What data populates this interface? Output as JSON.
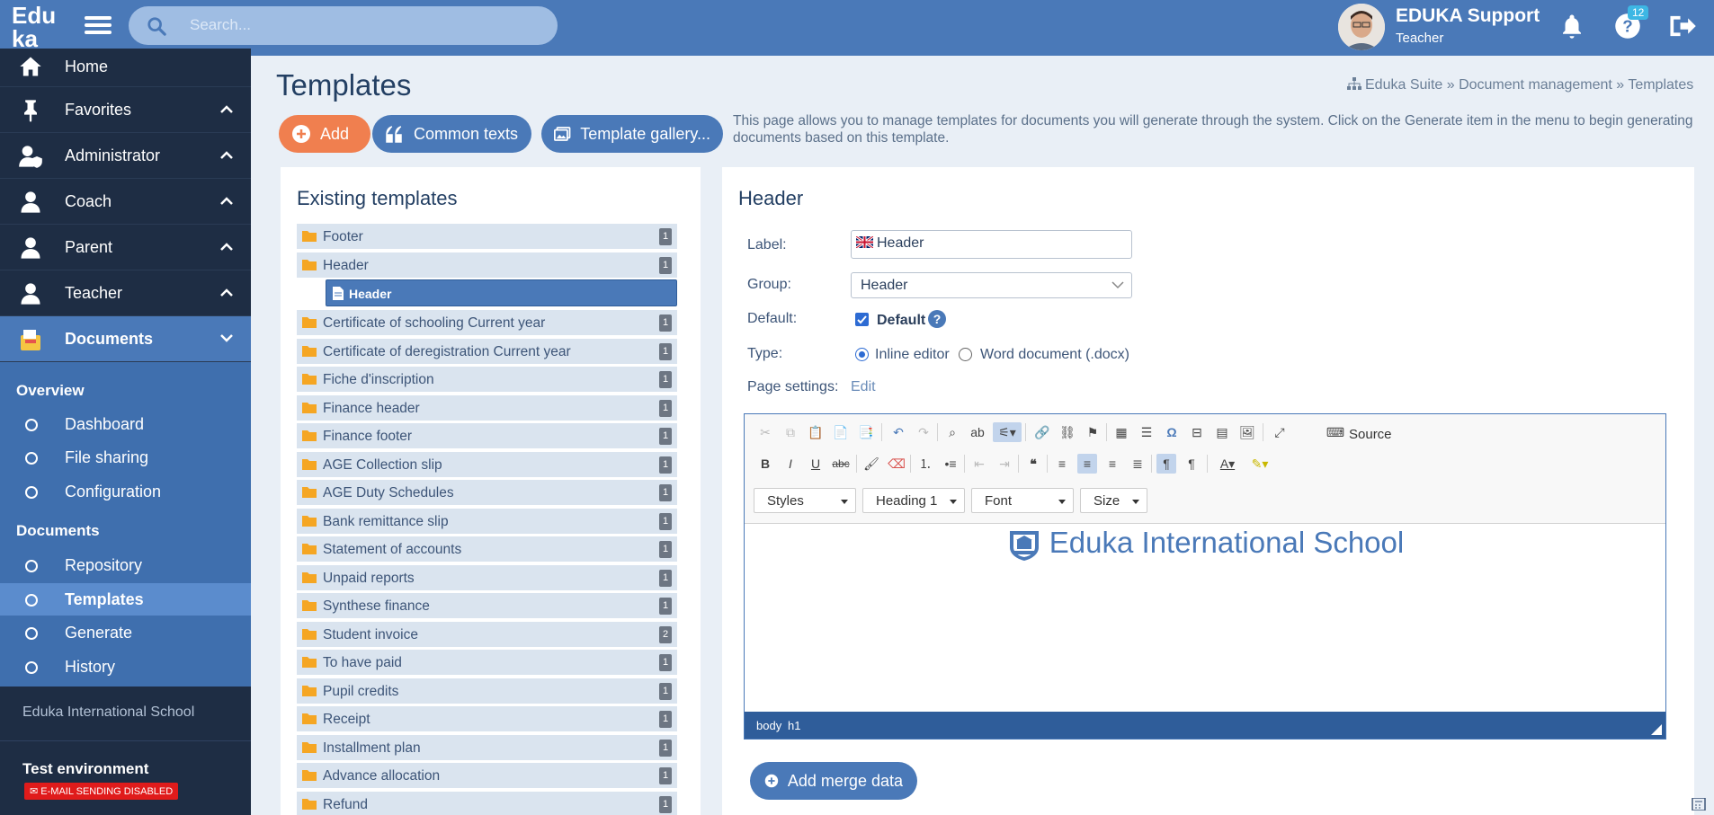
{
  "brand": {
    "logo_line1": "Edu",
    "logo_line2": "ka"
  },
  "search": {
    "placeholder": "Search..."
  },
  "user": {
    "name": "EDUKA Support",
    "role": "Teacher"
  },
  "notifications": {
    "help_count": "12"
  },
  "sidebar": {
    "items": [
      {
        "label": "Home"
      },
      {
        "label": "Favorites"
      },
      {
        "label": "Administrator"
      },
      {
        "label": "Coach"
      },
      {
        "label": "Parent"
      },
      {
        "label": "Teacher"
      },
      {
        "label": "Documents"
      }
    ],
    "sections": [
      {
        "title": "Overview",
        "items": [
          "Dashboard",
          "File sharing",
          "Configuration"
        ]
      },
      {
        "title": "Documents",
        "items": [
          "Repository",
          "Templates",
          "Generate",
          "History"
        ]
      }
    ],
    "selected_item": "Templates",
    "school": "Eduka International School",
    "env_label": "Test environment",
    "env_badge": "E-MAIL SENDING DISABLED"
  },
  "page": {
    "title": "Templates",
    "breadcrumb": "Eduka Suite » Document management » Templates",
    "buttons": {
      "add": "Add",
      "common_texts": "Common texts",
      "gallery": "Template gallery..."
    },
    "intro": "This page allows you to manage templates for documents you will generate through the system. Click on the Generate item in the menu to begin generating documents based on this template."
  },
  "templates": {
    "title": "Existing templates",
    "rows": [
      {
        "label": "Footer",
        "count": "1"
      },
      {
        "label": "Header",
        "count": "1"
      },
      {
        "label": "Certificate of schooling Current year",
        "count": "1"
      },
      {
        "label": "Certificate of deregistration Current year",
        "count": "1"
      },
      {
        "label": "Fiche d'inscription",
        "count": "1"
      },
      {
        "label": "Finance header",
        "count": "1"
      },
      {
        "label": "Finance footer",
        "count": "1"
      },
      {
        "label": "AGE Collection slip",
        "count": "1"
      },
      {
        "label": "AGE Duty Schedules",
        "count": "1"
      },
      {
        "label": "Bank remittance slip",
        "count": "1"
      },
      {
        "label": "Statement of accounts",
        "count": "1"
      },
      {
        "label": "Unpaid reports",
        "count": "1"
      },
      {
        "label": "Synthese finance",
        "count": "1"
      },
      {
        "label": "Student invoice",
        "count": "2"
      },
      {
        "label": "To have paid",
        "count": "1"
      },
      {
        "label": "Pupil credits",
        "count": "1"
      },
      {
        "label": "Receipt",
        "count": "1"
      },
      {
        "label": "Installment plan",
        "count": "1"
      },
      {
        "label": "Advance allocation",
        "count": "1"
      },
      {
        "label": "Refund",
        "count": "1"
      }
    ],
    "child": {
      "label": "Header"
    }
  },
  "detail": {
    "title": "Header",
    "label_label": "Label:",
    "label_value": "Header",
    "group_label": "Group:",
    "group_value": "Header",
    "default_label": "Default:",
    "default_check": "Default",
    "type_label": "Type:",
    "type_inline": "Inline editor",
    "type_word": "Word document (.docx)",
    "page_settings_label": "Page settings:",
    "page_settings_link": "Edit"
  },
  "editor": {
    "source_label": "Source",
    "combos": {
      "styles": "Styles",
      "format": "Heading 1",
      "font": "Font",
      "size": "Size"
    },
    "content_heading": "Eduka International School",
    "status_path": [
      "body",
      "h1"
    ]
  },
  "merge": {
    "label": "Add merge data"
  },
  "colors": {
    "accent": "#4a79b8",
    "dark_nav": "#1e2d44",
    "add_orange": "#f07f4f",
    "danger": "#e01b1b"
  }
}
